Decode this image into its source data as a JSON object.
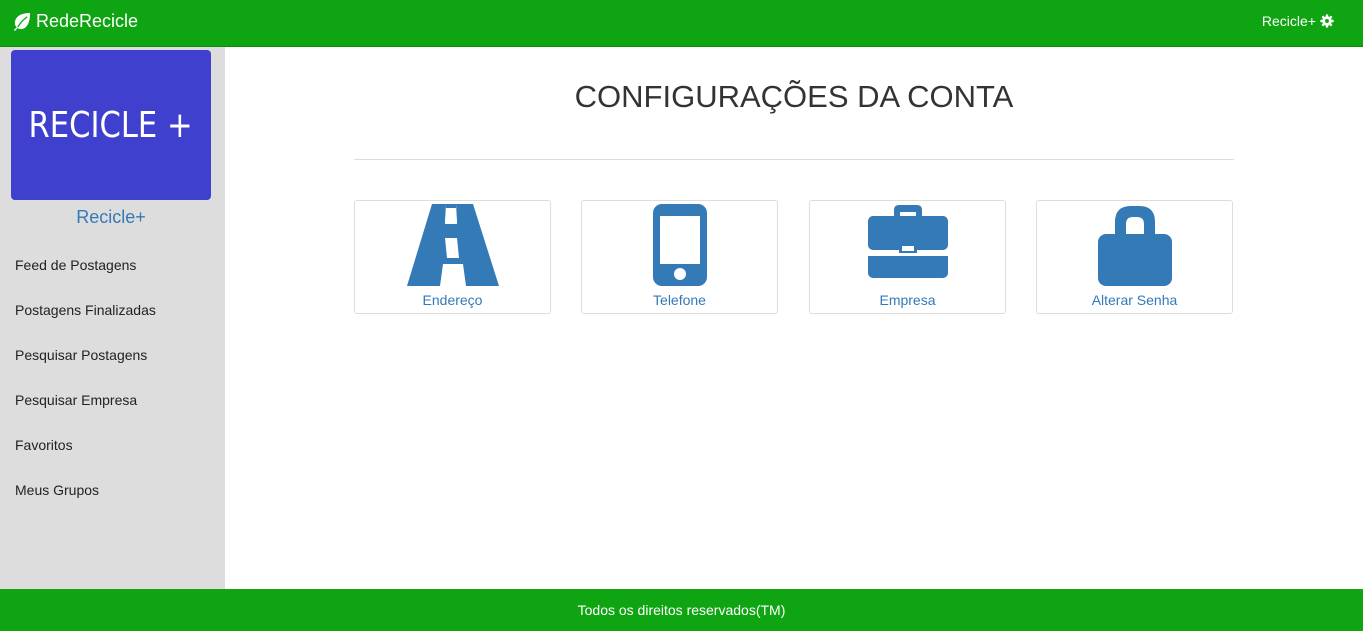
{
  "header": {
    "brand": "RedeRecicle",
    "brand_icon": "leaf-icon",
    "user_label": "Recicle+",
    "user_icon": "gear-icon",
    "color": "#0fa512"
  },
  "sidebar": {
    "logo_text": "RECICLE +",
    "logo_color": "#4040cf",
    "profile_name": "Recicle+",
    "items": [
      {
        "label": "Feed de Postagens"
      },
      {
        "label": "Postagens Finalizadas"
      },
      {
        "label": "Pesquisar Postagens"
      },
      {
        "label": "Pesquisar Empresa"
      },
      {
        "label": "Favoritos"
      },
      {
        "label": "Meus Grupos"
      }
    ]
  },
  "main": {
    "title": "CONFIGURAÇÕES DA CONTA",
    "cards": [
      {
        "label": "Endereço",
        "icon": "road-icon"
      },
      {
        "label": "Telefone",
        "icon": "phone-icon"
      },
      {
        "label": "Empresa",
        "icon": "briefcase-icon"
      },
      {
        "label": "Alterar Senha",
        "icon": "lock-icon"
      }
    ],
    "icon_color": "#337ab7"
  },
  "footer": {
    "text": "Todos os direitos reservados(TM)"
  }
}
